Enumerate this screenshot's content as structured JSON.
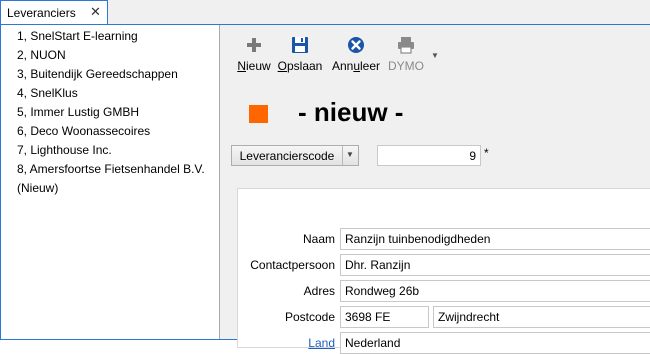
{
  "tab": {
    "label": "Leveranciers",
    "close_glyph": "✕"
  },
  "list": {
    "items": [
      "1, SnelStart E-learning",
      "2, NUON",
      "3, Buitendijk Gereedschappen",
      "4, SnelKlus",
      "5, Immer Lustig GMBH",
      "6, Deco Woonassecoires",
      "7, Lighthouse Inc.",
      "8, Amersfoortse Fietsenhandel B.V.",
      "(Nieuw)"
    ]
  },
  "toolbar": {
    "new_label_ul": "N",
    "new_label_rest": "ieuw",
    "save_label_ul": "O",
    "save_label_rest": "pslaan",
    "cancel_label_pre": "Ann",
    "cancel_label_ul": "u",
    "cancel_label_rest": "leer",
    "dymo_label": "DYMO",
    "icons": [
      "plus-icon",
      "floppy-disk-icon",
      "cancel-circle-icon",
      "printer-icon",
      "dropdown-arrow-icon"
    ]
  },
  "header": {
    "title": "- nieuw -",
    "accent_color": "#ff6600"
  },
  "code": {
    "button_label": "Leverancierscode",
    "value": "9",
    "required_marker": "*"
  },
  "form": {
    "name_label": "Naam",
    "name_value": "Ranzijn tuinbenodigdheden",
    "contact_label": "Contactpersoon",
    "contact_value": "Dhr. Ranzijn",
    "address_label": "Adres",
    "address_value": "Rondweg 26b",
    "postcode_label": "Postcode",
    "postcode_value": "3698 FE",
    "city_value": "Zwijndrecht",
    "country_label": "Land",
    "country_value": "Nederland"
  },
  "colors": {
    "accent": "#ff6600",
    "tab_border": "#2b79d4",
    "link": "#1f5fbf",
    "save_icon": "#1a56a8"
  }
}
